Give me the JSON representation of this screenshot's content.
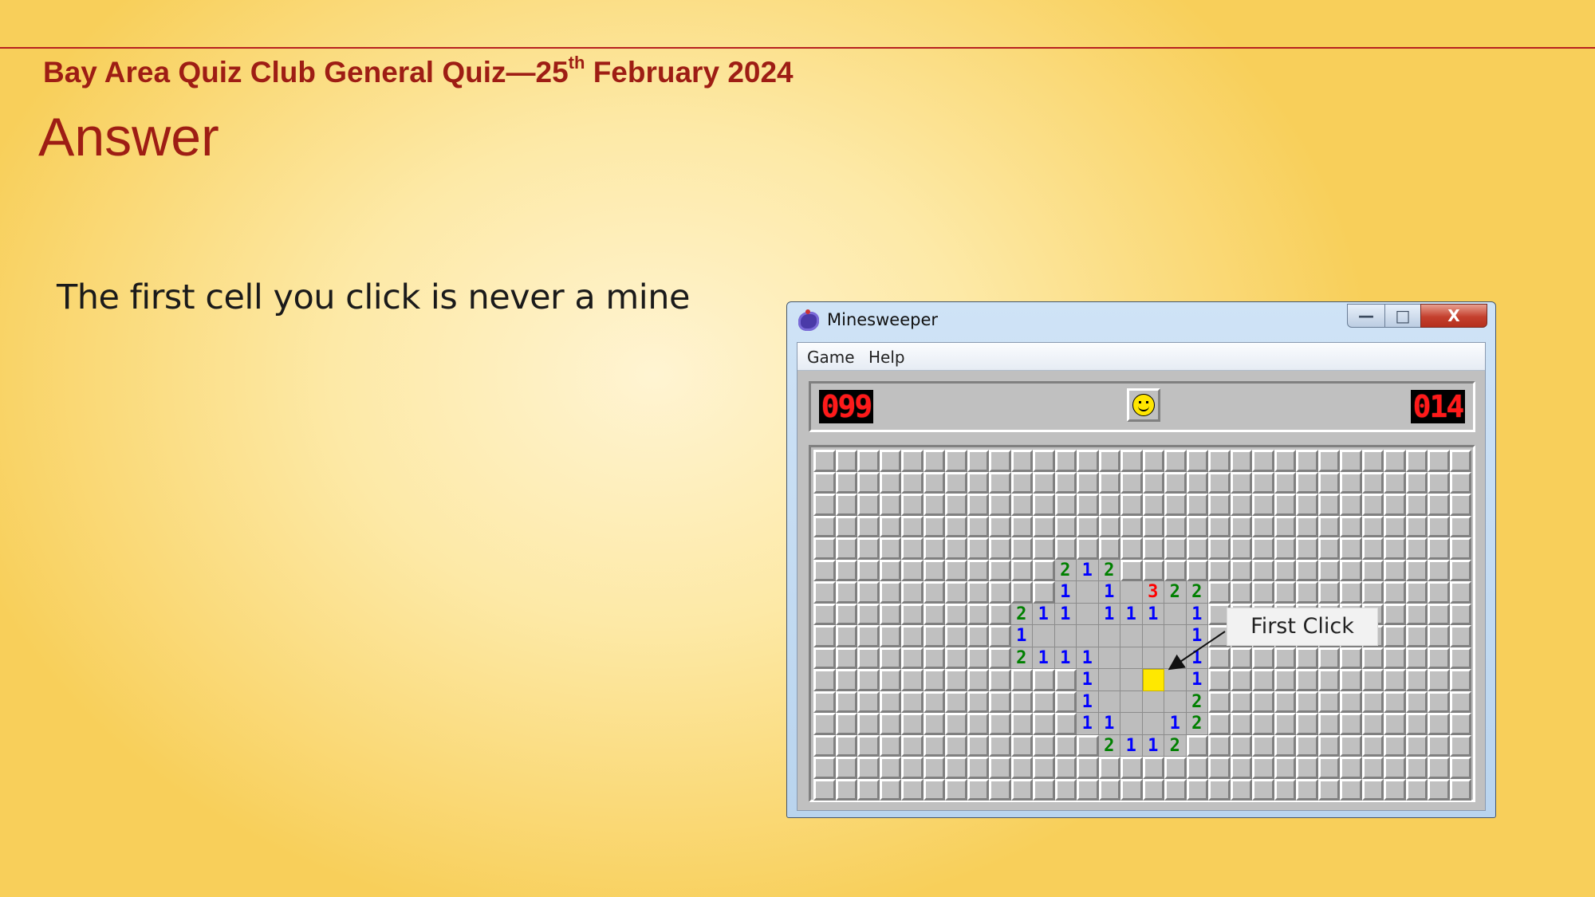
{
  "slide": {
    "header_pre": "Bay Area Quiz Club General Quiz—25",
    "header_sup": "th",
    "header_post": " February 2024",
    "title": "Answer",
    "statement": "The first cell you click is never a mine"
  },
  "window": {
    "title": "Minesweeper",
    "menu": [
      "Game",
      "Help"
    ],
    "mine_counter": "099",
    "timer": "014",
    "controls": {
      "minimize": "—",
      "maximize": "□",
      "close": "X"
    }
  },
  "board": {
    "cols": 30,
    "rows": 16,
    "opened_cells": [
      [
        5,
        11,
        "2"
      ],
      [
        5,
        12,
        "1"
      ],
      [
        5,
        13,
        "2"
      ],
      [
        6,
        11,
        "1"
      ],
      [
        6,
        12,
        ""
      ],
      [
        6,
        13,
        "1"
      ],
      [
        6,
        14,
        ""
      ],
      [
        6,
        15,
        "3"
      ],
      [
        6,
        16,
        "2"
      ],
      [
        6,
        17,
        "2"
      ],
      [
        7,
        9,
        "2"
      ],
      [
        7,
        10,
        "1"
      ],
      [
        7,
        11,
        "1"
      ],
      [
        7,
        12,
        ""
      ],
      [
        7,
        13,
        "1"
      ],
      [
        7,
        14,
        "1"
      ],
      [
        7,
        15,
        "1"
      ],
      [
        7,
        16,
        ""
      ],
      [
        7,
        17,
        "1"
      ],
      [
        8,
        9,
        "1"
      ],
      [
        8,
        10,
        ""
      ],
      [
        8,
        11,
        ""
      ],
      [
        8,
        12,
        ""
      ],
      [
        8,
        13,
        ""
      ],
      [
        8,
        14,
        ""
      ],
      [
        8,
        15,
        ""
      ],
      [
        8,
        16,
        ""
      ],
      [
        8,
        17,
        "1"
      ],
      [
        9,
        9,
        "2"
      ],
      [
        9,
        10,
        "1"
      ],
      [
        9,
        11,
        "1"
      ],
      [
        9,
        12,
        "1"
      ],
      [
        9,
        13,
        ""
      ],
      [
        9,
        14,
        ""
      ],
      [
        9,
        15,
        ""
      ],
      [
        9,
        16,
        ""
      ],
      [
        9,
        17,
        "1"
      ],
      [
        10,
        12,
        "1"
      ],
      [
        10,
        13,
        ""
      ],
      [
        10,
        14,
        ""
      ],
      [
        10,
        15,
        "Y"
      ],
      [
        10,
        16,
        ""
      ],
      [
        10,
        17,
        "1"
      ],
      [
        11,
        12,
        "1"
      ],
      [
        11,
        13,
        ""
      ],
      [
        11,
        14,
        ""
      ],
      [
        11,
        15,
        ""
      ],
      [
        11,
        16,
        ""
      ],
      [
        11,
        17,
        "2"
      ],
      [
        12,
        12,
        "1"
      ],
      [
        12,
        13,
        "1"
      ],
      [
        12,
        14,
        ""
      ],
      [
        12,
        15,
        ""
      ],
      [
        12,
        16,
        "1"
      ],
      [
        12,
        17,
        "2"
      ],
      [
        13,
        13,
        "2"
      ],
      [
        13,
        14,
        "1"
      ],
      [
        13,
        15,
        "1"
      ],
      [
        13,
        16,
        "2"
      ]
    ],
    "first_click_cell": [
      10,
      15
    ]
  },
  "annotation": {
    "label": "First Click"
  },
  "colors": {
    "header_red": "#9e1d14",
    "number_1": "#0000ff",
    "number_2": "#008000",
    "number_3": "#ff0000",
    "first_click": "#ffe800"
  }
}
